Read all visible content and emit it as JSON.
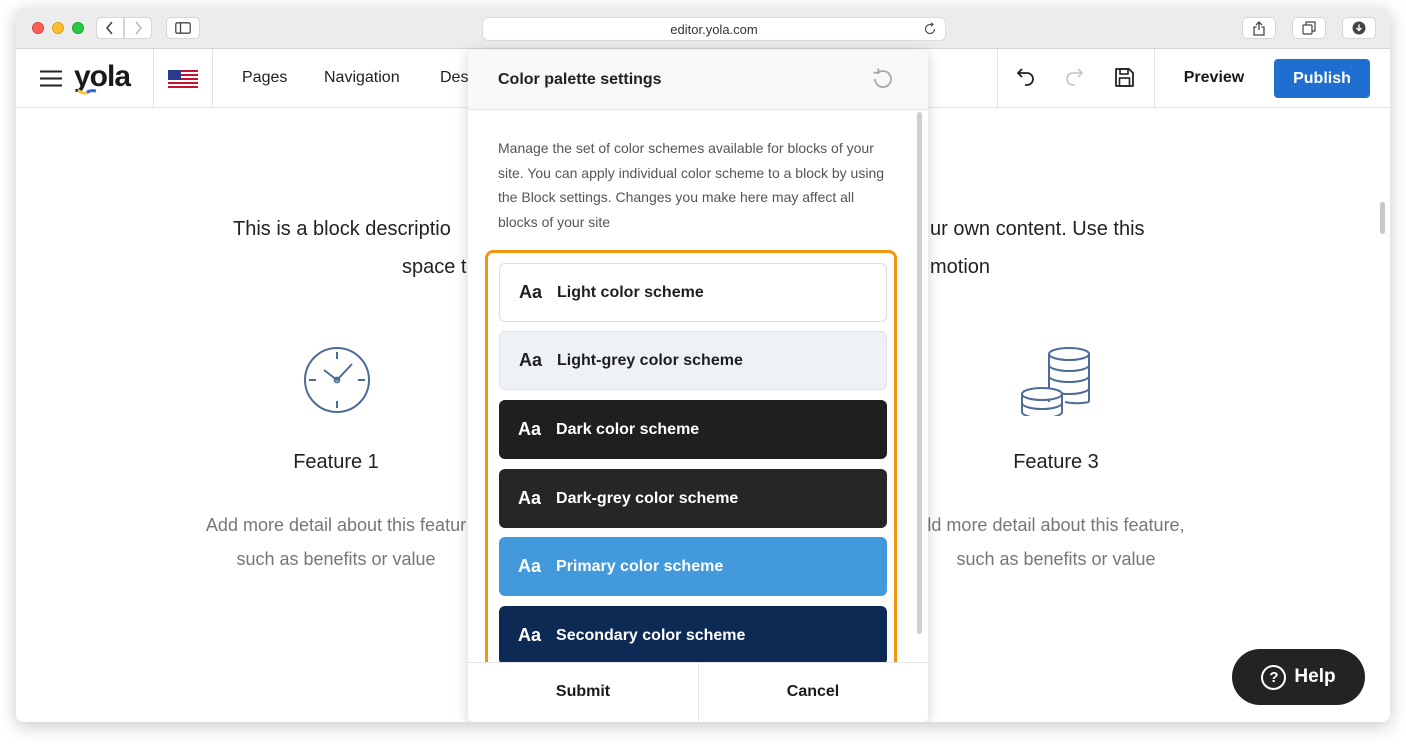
{
  "browser": {
    "url": "editor.yola.com"
  },
  "toolbar": {
    "logo": "yola",
    "nav": [
      "Pages",
      "Navigation",
      "Des"
    ],
    "preview_label": "Preview",
    "publish_label": "Publish",
    "accent_color": "#1f6fd1"
  },
  "page": {
    "description_lines": [
      "This is a block descriptio",
      "ur own content. Use this",
      "space t",
      "motion"
    ],
    "features": [
      {
        "title": "Feature 1",
        "text_lines": [
          "Add more detail about this featur",
          "such as benefits or value"
        ],
        "icon": "clock-icon"
      },
      {
        "title": "Feature 3",
        "text_lines": [
          "ld more detail about this feature,",
          "such as benefits or value"
        ],
        "icon": "coins-icon"
      }
    ],
    "help_label": "Help"
  },
  "modal": {
    "title": "Color palette settings",
    "description": "Manage the set of color schemes available for blocks of your site. You can apply individual color scheme to a block by using the Block settings. Changes you make here may affect all blocks of your site",
    "highlight_color": "#f5940f",
    "schemes": [
      {
        "aa": "Aa",
        "label": "Light color scheme",
        "bg": "#ffffff",
        "fg": "#1f1f1f"
      },
      {
        "aa": "Aa",
        "label": "Light-grey color scheme",
        "bg": "#eef2f6",
        "fg": "#1f1f1f"
      },
      {
        "aa": "Aa",
        "label": "Dark color scheme",
        "bg": "#1f1f1f",
        "fg": "#ffffff"
      },
      {
        "aa": "Aa",
        "label": "Dark-grey color scheme",
        "bg": "#262626",
        "fg": "#ffffff"
      },
      {
        "aa": "Aa",
        "label": "Primary color scheme",
        "bg": "#4299dc",
        "fg": "#ffffff"
      },
      {
        "aa": "Aa",
        "label": "Secondary color scheme",
        "bg": "#0d2a55",
        "fg": "#ffffff"
      }
    ],
    "submit_label": "Submit",
    "cancel_label": "Cancel"
  }
}
